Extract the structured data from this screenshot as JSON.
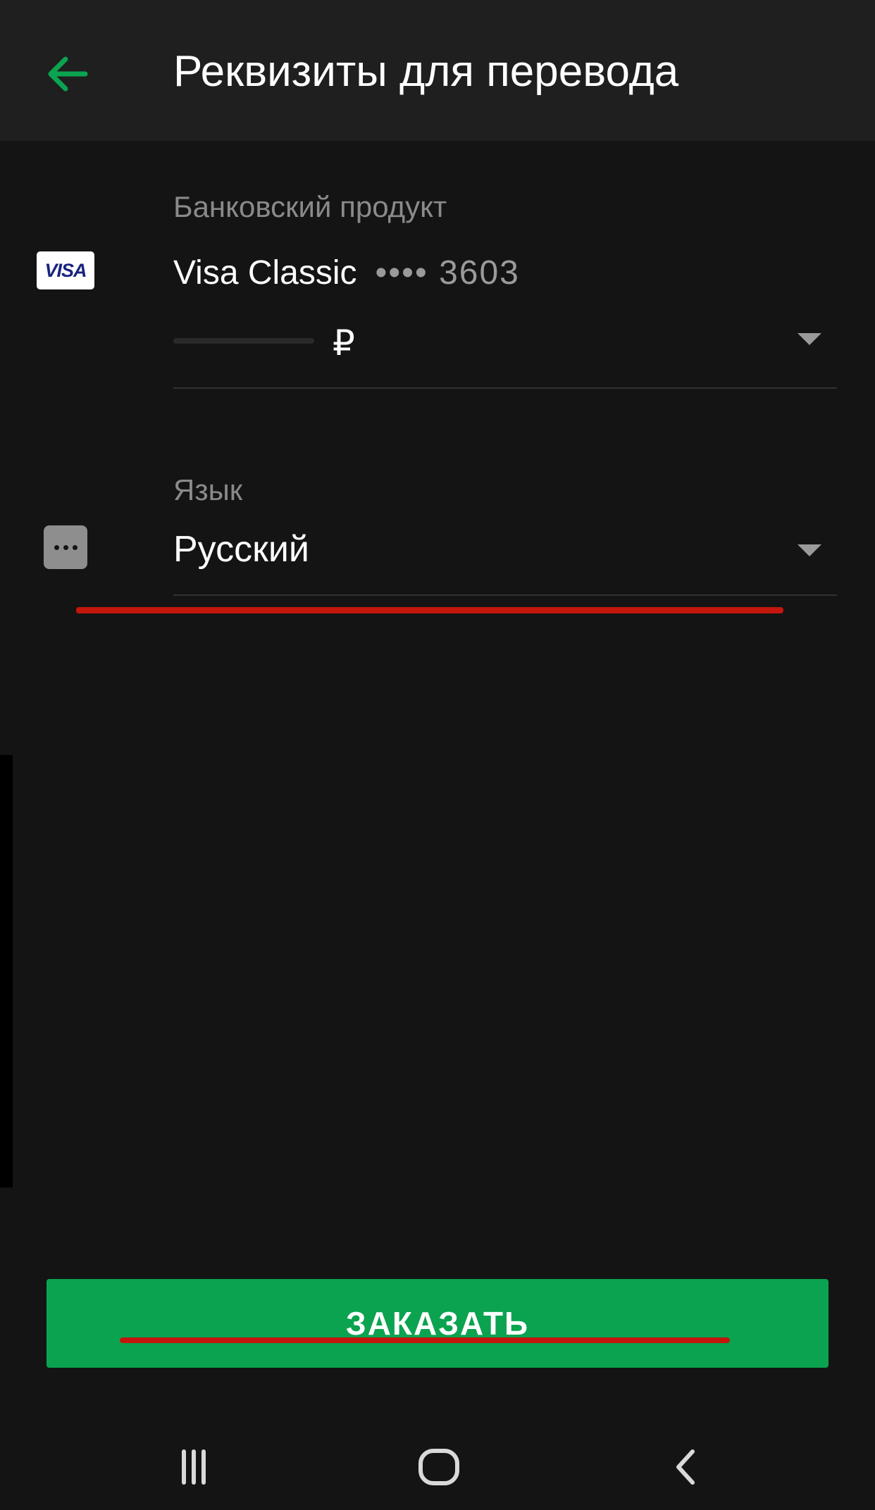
{
  "header": {
    "title": "Реквизиты для перевода",
    "back_icon": "arrow-left-icon",
    "accent_color": "#0ba350"
  },
  "product": {
    "label": "Банковский продукт",
    "card_brand": "VISA",
    "card_name": "Visa Classic",
    "card_mask": "•••• 3603",
    "balance_currency": "₽"
  },
  "language": {
    "label": "Язык",
    "value": "Русский",
    "icon": "more-dots-icon"
  },
  "order_button": {
    "label": "ЗАКАЗАТЬ",
    "color": "#0ba350"
  },
  "system_nav": {
    "recents_icon": "recents-icon",
    "home_icon": "home-icon",
    "back_icon": "chevron-left-icon"
  },
  "annotation_color": "#c4160c"
}
